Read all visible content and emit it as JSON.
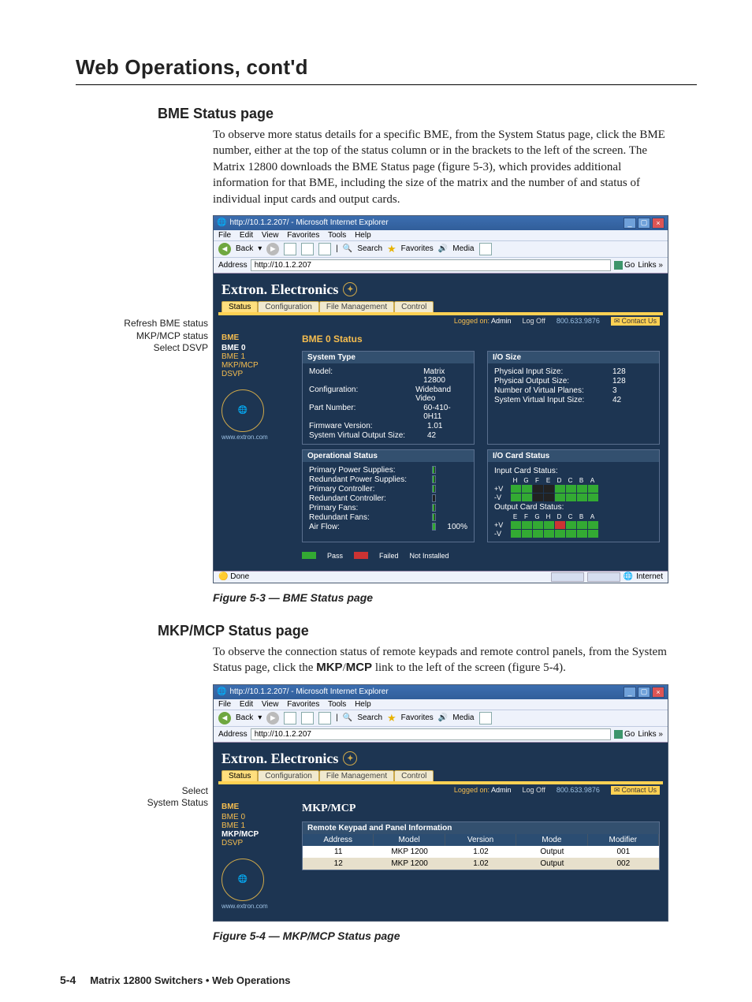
{
  "header": {
    "title": "Web Operations, cont'd"
  },
  "section_bme": {
    "title": "BME Status page",
    "paragraph": "To observe more status details for a specific BME, from the System Status page, click the BME number, either at the top of the status column or in the brackets to the left of the screen.  The Matrix 12800 downloads the BME Status page (figure 5-3), which provides additional information for that BME, including the size of the matrix and the number of and status of individual input cards and output cards."
  },
  "callouts_bme": {
    "a": "Refresh BME status",
    "b": "MKP/MCP status",
    "c": "Select DSVP"
  },
  "caption_bme": "Figure 5-3 — BME Status page",
  "section_mkp": {
    "title": "MKP/MCP Status page",
    "para_a": "To observe the connection status of remote keypads and remote control panels, from the System Status page, click the ",
    "para_b": "MKP",
    "para_c": "/",
    "para_d": "MCP",
    "para_e": " link to the left of the screen (figure 5-4)."
  },
  "callouts_mkp": {
    "a": "Select",
    "b": "System Status"
  },
  "caption_mkp": "Figure 5-4 — MKP/MCP Status page",
  "footer": {
    "page": "5-4",
    "text": "Matrix 12800 Switchers • Web Operations"
  },
  "ie": {
    "title": "http://10.1.2.207/ - Microsoft Internet Explorer",
    "menu": {
      "file": "File",
      "edit": "Edit",
      "view": "View",
      "favorites": "Favorites",
      "tools": "Tools",
      "help": "Help"
    },
    "toolbar": {
      "back": "Back",
      "search": "Search",
      "favorites": "Favorites",
      "media": "Media"
    },
    "address_label": "Address",
    "address_value": "http://10.1.2.207",
    "go": "Go",
    "links": "Links »",
    "brand": "Extron. Electronics",
    "tabs": {
      "status": "Status",
      "configuration": "Configuration",
      "file_mgmt": "File Management",
      "control": "Control"
    },
    "phone": "800.633.9876",
    "logged_prefix": "Logged on:",
    "logged_user": "Admin",
    "logoff": "Log Off",
    "contact": "Contact Us",
    "done": "Done",
    "zone": "Internet",
    "url_small": "www.extron.com"
  },
  "bme_page": {
    "title": "BME 0 Status",
    "side_hdr": "BME",
    "side_items": [
      "BME 0",
      "BME 1",
      "MKP/MCP",
      "DSVP"
    ],
    "system_type_h": "System Type",
    "io_size_h": "I/O Size",
    "sys_rows": [
      {
        "k": "Model:",
        "v": "Matrix 12800"
      },
      {
        "k": "Configuration:",
        "v": "Wideband Video"
      },
      {
        "k": "Part Number:",
        "v": "60-410-0H11"
      },
      {
        "k": "Firmware Version:",
        "v": "1.01"
      },
      {
        "k": "System Virtual Output Size:",
        "v": "42"
      }
    ],
    "io_rows": [
      {
        "k": "Physical Input Size:",
        "v": "128"
      },
      {
        "k": "Physical Output Size:",
        "v": "128"
      },
      {
        "k": "Number of Virtual Planes:",
        "v": "3"
      },
      {
        "k": "System Virtual Input Size:",
        "v": "42"
      }
    ],
    "op_status_h": "Operational Status",
    "card_status_h": "I/O Card Status",
    "op_rows": [
      {
        "k": "Primary Power Supplies:",
        "pct": 80,
        "v": ""
      },
      {
        "k": "Redundant Power Supplies:",
        "pct": 80,
        "v": ""
      },
      {
        "k": "Primary Controller:",
        "pct": 80,
        "v": ""
      },
      {
        "k": "Redundant Controller:",
        "pct": 0,
        "v": ""
      },
      {
        "k": "Primary Fans:",
        "pct": 80,
        "v": ""
      },
      {
        "k": "Redundant Fans:",
        "pct": 80,
        "v": ""
      },
      {
        "k": "Air Flow:",
        "pct": 100,
        "v": "100%"
      }
    ],
    "input_label": "Input Card Status:",
    "output_label": "Output Card Status:",
    "legend": {
      "pass": "Pass",
      "failed": "Failed",
      "ni": "Not Installed"
    },
    "pv": "+V",
    "mv": "-V"
  },
  "mkp_page": {
    "title": "MKP/MCP",
    "side_hdr": "BME",
    "side_items": [
      "BME 0",
      "BME 1",
      "MKP/MCP",
      "DSVP"
    ],
    "table_title": "Remote Keypad and Panel Information",
    "headers": [
      "Address",
      "Model",
      "Version",
      "Mode",
      "Modifier"
    ],
    "rows": [
      [
        "11",
        "MKP 1200",
        "1.02",
        "Output",
        "001"
      ],
      [
        "12",
        "MKP 1200",
        "1.02",
        "Output",
        "002"
      ]
    ]
  },
  "chart_data": {
    "type": "table",
    "title": "Remote Keypad and Panel Information",
    "columns": [
      "Address",
      "Model",
      "Version",
      "Mode",
      "Modifier"
    ],
    "rows": [
      [
        "11",
        "MKP 1200",
        "1.02",
        "Output",
        "001"
      ],
      [
        "12",
        "MKP 1200",
        "1.02",
        "Output",
        "002"
      ]
    ]
  }
}
